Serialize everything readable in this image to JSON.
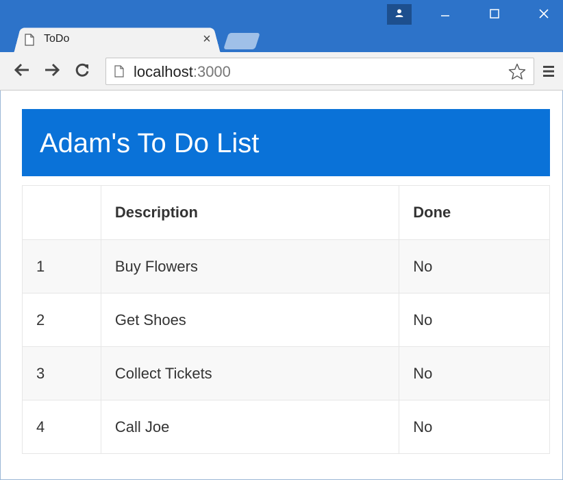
{
  "window": {
    "tab_title": "ToDo",
    "tab_close": "×",
    "accent_color": "#2d73c9"
  },
  "toolbar": {
    "url_host": "localhost",
    "url_port": ":3000"
  },
  "page": {
    "title": "Adam's To Do List",
    "header_color": "#0a72d8",
    "table": {
      "columns": [
        "",
        "Description",
        "Done"
      ],
      "rows": [
        {
          "num": "1",
          "description": "Buy Flowers",
          "done": "No"
        },
        {
          "num": "2",
          "description": "Get Shoes",
          "done": "No"
        },
        {
          "num": "3",
          "description": "Collect Tickets",
          "done": "No"
        },
        {
          "num": "4",
          "description": "Call Joe",
          "done": "No"
        }
      ]
    }
  },
  "icons": {
    "tab_page": "page-icon",
    "profile": "person-icon",
    "minimize": "minimize-icon",
    "maximize": "maximize-icon",
    "close": "close-icon",
    "back": "back-arrow-icon",
    "forward": "forward-arrow-icon",
    "reload": "reload-icon",
    "omnibox_page": "page-icon",
    "bookmark": "star-icon",
    "menu": "hamburger-menu-icon"
  }
}
